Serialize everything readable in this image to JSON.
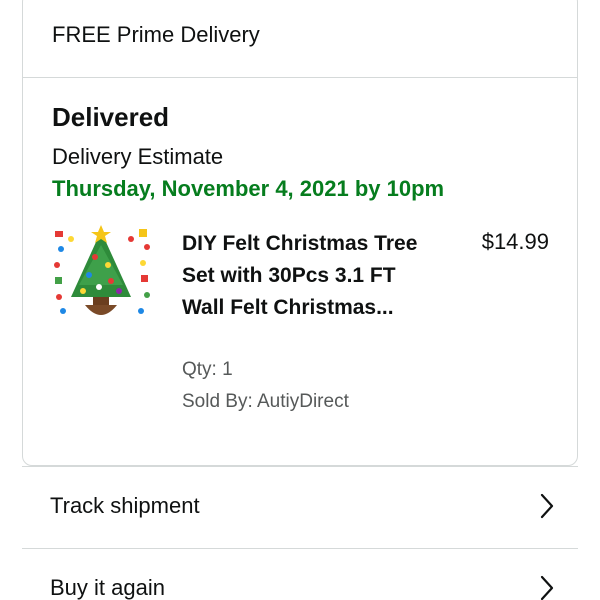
{
  "order_card": {
    "delivery_type": "FREE Prime Delivery",
    "status": "Delivered",
    "estimate_label": "Delivery Estimate",
    "estimate_date": "Thursday, November 4, 2021 by 10pm",
    "accent_color": "#067d1e",
    "item": {
      "title": "DIY Felt Christmas Tree Set with 30Pcs 3.1 FT Wall Felt Christmas...",
      "price": "$14.99",
      "quantity": "Qty: 1",
      "seller": "Sold By: AutiyDirect",
      "thumbnail_icon": "felt-christmas-tree-image"
    }
  },
  "actions": [
    {
      "label": "Track shipment",
      "icon": "chevron-right-icon"
    },
    {
      "label": "Buy it again",
      "icon": "chevron-right-icon"
    }
  ]
}
